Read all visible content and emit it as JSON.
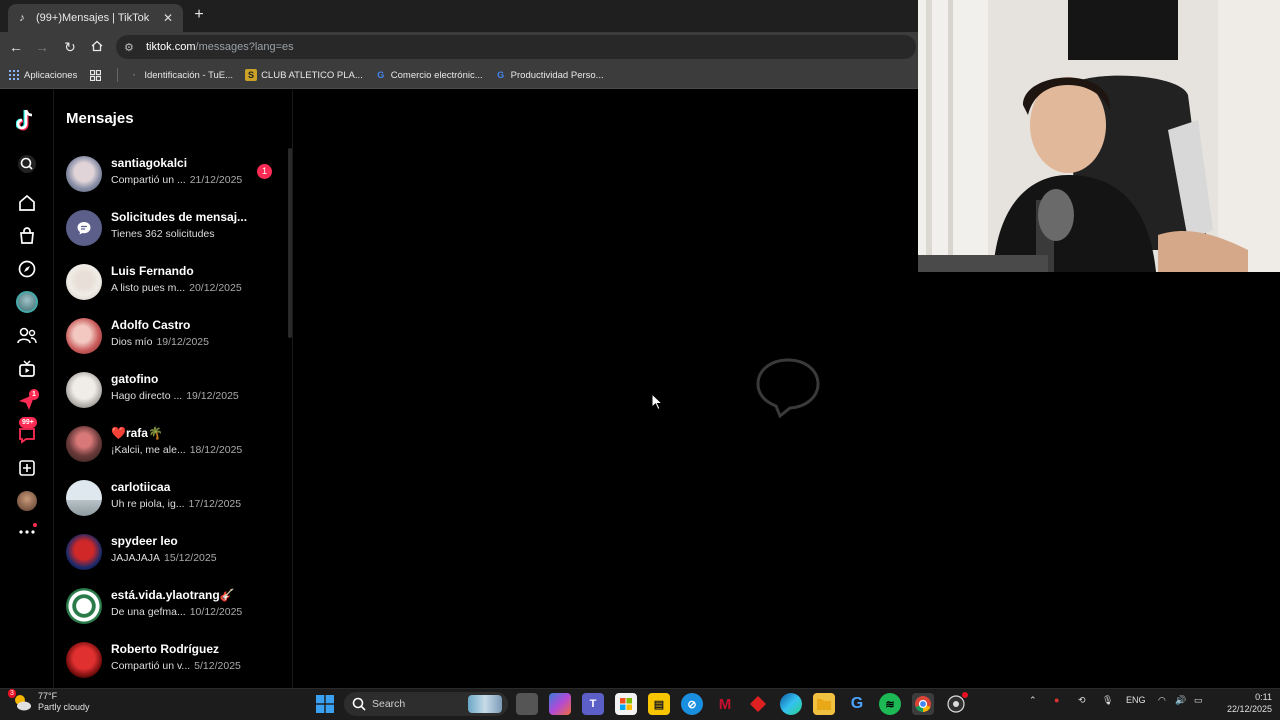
{
  "browser": {
    "tab": {
      "title": "(99+)Mensajes | TikTok"
    },
    "address": {
      "host": "tiktok.com",
      "path": "/messages?lang=es"
    },
    "bookmarks": [
      {
        "label": "Aplicaciones",
        "icon": "apps-grid-icon"
      },
      {
        "label": "Identificación - TuE...",
        "icon": "doc-icon"
      },
      {
        "label": "CLUB ATLETICO PLA...",
        "icon": "club-icon"
      },
      {
        "label": "Comercio electrónic...",
        "icon": "google-icon"
      },
      {
        "label": "Productividad Perso...",
        "icon": "google-icon"
      }
    ]
  },
  "tiktok": {
    "panel_title": "Mensajes",
    "nav_badges": {
      "activity": "1",
      "messages": "99+"
    },
    "conversations": [
      {
        "name": "santiagokalci",
        "preview": "Compartió un ...",
        "date": "21/12/2025",
        "unread": "1"
      },
      {
        "name": "Solicitudes de mensaj...",
        "preview": "Tienes 362 solicitudes",
        "date": ""
      },
      {
        "name": "Luis Fernando",
        "preview": "A listo pues m...",
        "date": "20/12/2025"
      },
      {
        "name": "Adolfo Castro",
        "preview": "Dios mío",
        "date": "19/12/2025"
      },
      {
        "name": "gatofino",
        "preview": "Hago directo ...",
        "date": "19/12/2025"
      },
      {
        "name": "❤️rafa🌴",
        "preview": "¡Kalcii, me ale...",
        "date": "18/12/2025"
      },
      {
        "name": "carlotiicaa",
        "preview": "Uh re piola, ig...",
        "date": "17/12/2025"
      },
      {
        "name": "spydeer leo",
        "preview": "JAJAJAJA",
        "date": "15/12/2025"
      },
      {
        "name": "está.vida.ylaotrang🎸",
        "preview": "De una gefma...",
        "date": "10/12/2025"
      },
      {
        "name": "Roberto Rodríguez",
        "preview": "Compartió un v...",
        "date": "5/12/2025"
      }
    ]
  },
  "taskbar": {
    "weather": {
      "temp": "77°F",
      "desc": "Partly cloudy",
      "badge": "3"
    },
    "search_placeholder": "Search",
    "language": "ENG",
    "time": "0:11",
    "date": "22/12/2025"
  },
  "colors": {
    "accent": "#fe2c55",
    "chrome_bg": "#3c3c3c",
    "app_bg": "#000000"
  }
}
